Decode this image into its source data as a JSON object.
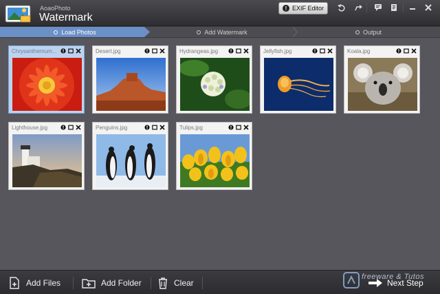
{
  "app": {
    "subtitle": "AoaoPhoto",
    "title": "Watermark",
    "exif_label": "EXIF Editor",
    "exif_icon": "info-icon"
  },
  "steps": [
    {
      "label": "Load Photos",
      "active": true
    },
    {
      "label": "Add Watermark",
      "active": false
    },
    {
      "label": "Output",
      "active": false
    }
  ],
  "photos": [
    {
      "name": "Chrysanthemum...",
      "selected": true,
      "image": "red-flower"
    },
    {
      "name": "Desert.jpg",
      "selected": false,
      "image": "desert-mesa"
    },
    {
      "name": "Hydrangeas.jpg",
      "selected": false,
      "image": "white-hydrangea"
    },
    {
      "name": "Jellyfish.jpg",
      "selected": false,
      "image": "orange-jellyfish"
    },
    {
      "name": "Koala.jpg",
      "selected": false,
      "image": "koala"
    },
    {
      "name": "Lighthouse.jpg",
      "selected": false,
      "image": "lighthouse"
    },
    {
      "name": "Penguins.jpg",
      "selected": false,
      "image": "penguins"
    },
    {
      "name": "Tulips.jpg",
      "selected": false,
      "image": "yellow-tulips"
    }
  ],
  "bottom": {
    "add_files": "Add Files",
    "add_folder": "Add Folder",
    "clear": "Clear",
    "next_step": "Next Step"
  },
  "watermark_text": "freeware & Tutos",
  "colors": {
    "accent": "#6b8fc7",
    "background": "#56565c",
    "titlebar": "#2e2e32"
  }
}
